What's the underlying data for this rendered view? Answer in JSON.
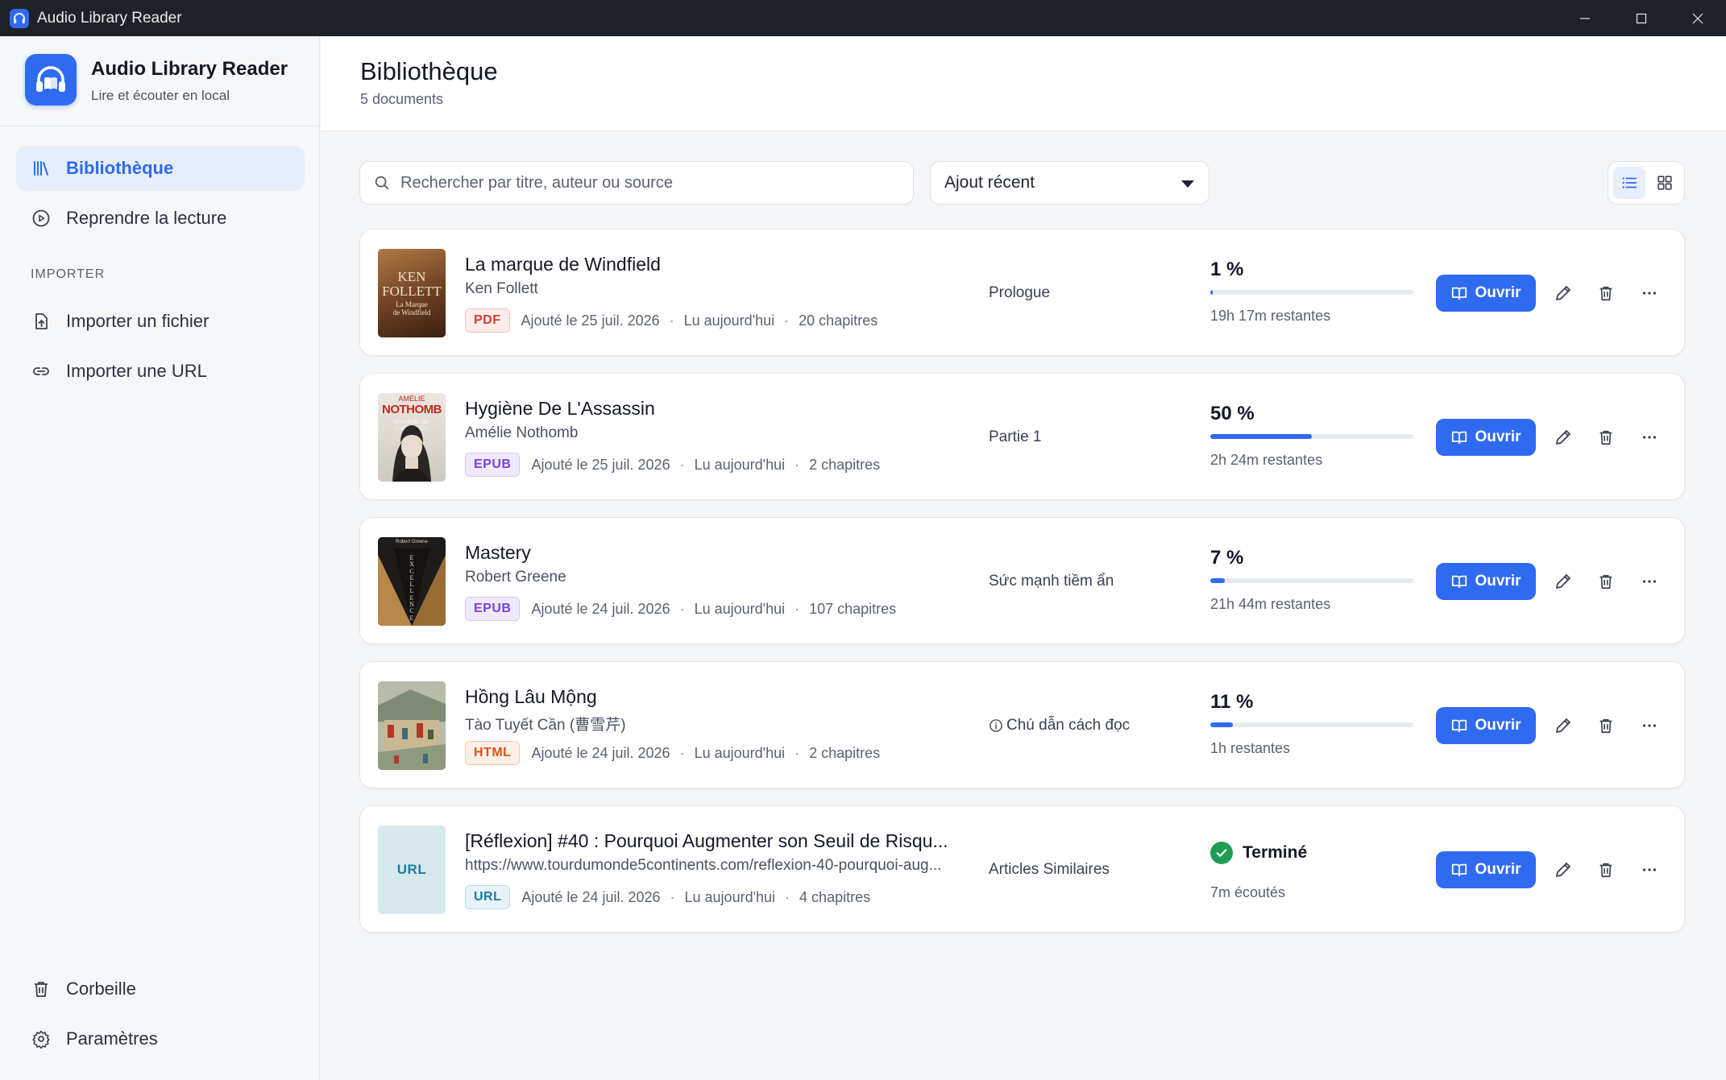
{
  "window": {
    "title": "Audio Library Reader"
  },
  "sidebar": {
    "app_name": "Audio Library Reader",
    "app_tagline": "Lire et écouter en local",
    "nav": [
      {
        "label": "Bibliothèque",
        "icon": "library-icon",
        "active": true
      },
      {
        "label": "Reprendre la lecture",
        "icon": "play-circle-icon",
        "active": false
      }
    ],
    "import_section": "IMPORTER",
    "import_items": [
      {
        "label": "Importer un fichier",
        "icon": "file-upload-icon"
      },
      {
        "label": "Importer une URL",
        "icon": "link-icon"
      }
    ],
    "footer_items": [
      {
        "label": "Corbeille",
        "icon": "trash-icon"
      },
      {
        "label": "Paramètres",
        "icon": "gear-icon"
      }
    ]
  },
  "header": {
    "title": "Bibliothèque",
    "count": "5 documents"
  },
  "toolbar": {
    "search_placeholder": "Rechercher par titre, auteur ou source",
    "sort_value": "Ajout récent",
    "view_mode": "list"
  },
  "open_label": "Ouvrir",
  "books": [
    {
      "title": "La marque de Windfield",
      "author": "Ken Follett",
      "format": "PDF",
      "added": "Ajouté le 25 juil. 2026",
      "read": "Lu aujourd'hui",
      "chapters": "20 chapitres",
      "current_chapter": "Prologue",
      "progress_label": "1 %",
      "progress": 0.01,
      "remaining": "19h 17m restantes",
      "cover": {
        "kind": "image",
        "lines": [
          "KEN",
          "FOLLETT",
          "La Marque",
          "de Windfield"
        ],
        "bg": "#7a4a2a"
      }
    },
    {
      "title": "Hygiène De L'Assassin",
      "author": "Amélie Nothomb",
      "format": "EPUB",
      "added": "Ajouté le 25 juil. 2026",
      "read": "Lu aujourd'hui",
      "chapters": "2 chapitres",
      "current_chapter": "Partie 1",
      "progress_label": "50 %",
      "progress": 0.5,
      "remaining": "2h 24m restantes",
      "cover": {
        "kind": "image",
        "lines": [
          "AMÉLIE",
          "NOTHOMB",
          "HYGIÈNE DE",
          "L'ASSASSIN"
        ],
        "bg": "#d9d4cc"
      }
    },
    {
      "title": "Mastery",
      "author": "Robert Greene",
      "format": "EPUB",
      "added": "Ajouté le 24 juil. 2026",
      "read": "Lu aujourd'hui",
      "chapters": "107 chapitres",
      "current_chapter": "Sức mạnh tiềm ẩn",
      "progress_label": "7 %",
      "progress": 0.07,
      "remaining": "21h 44m restantes",
      "cover": {
        "kind": "image",
        "lines": [
          "Robert Greene",
          "EXCELLENCE"
        ],
        "bg": "#1d1c1a"
      }
    },
    {
      "title": "Hồng Lâu Mộng",
      "author": "Tào Tuyết Cần (曹雪芹)",
      "format": "HTML",
      "added": "Ajouté le 24 juil. 2026",
      "read": "Lu aujourd'hui",
      "chapters": "2 chapitres",
      "current_chapter": "Chú dẫn cách đọc",
      "current_chapter_icon": "info-icon",
      "progress_label": "11 %",
      "progress": 0.11,
      "remaining": "1h restantes",
      "cover": {
        "kind": "image",
        "lines": [],
        "bg": "#8d9a86"
      }
    },
    {
      "title": "[Réflexion] #40 : Pourquoi Augmenter son Seuil de Risqu...",
      "author": "https://www.tourdumonde5continents.com/reflexion-40-pourquoi-aug...",
      "format": "URL",
      "added": "Ajouté le 24 juil. 2026",
      "read": "Lu aujourd'hui",
      "chapters": "4 chapitres",
      "current_chapter": "Articles Similaires",
      "status": "Terminé",
      "listened": "7m écoutés",
      "cover": {
        "kind": "label",
        "label": "URL",
        "bg": "#d6e9ee"
      }
    }
  ]
}
